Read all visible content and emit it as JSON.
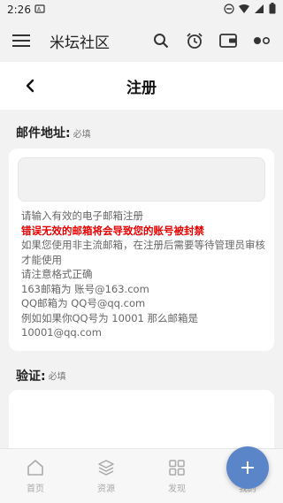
{
  "status_bar": {
    "time": "2:26"
  },
  "app_bar": {
    "title": "米坛社区"
  },
  "page": {
    "title": "注册"
  },
  "email_section": {
    "label": "邮件地址:",
    "required": "必填",
    "input_value": "",
    "hints": [
      "请输入有效的电子邮箱注册",
      "错误无效的邮箱将会导致您的账号被封禁",
      "如果您使用非主流邮箱，在注册后需要等待管理员审核才能使用",
      "请注意格式正确",
      "163邮箱为 账号@163.com",
      "QQ邮箱为 QQ号@qq.com",
      "例如如果你QQ号为 10001 那么邮箱是 10001@qq.com"
    ]
  },
  "verify_section": {
    "label": "验证:",
    "required": "必填"
  },
  "bottom_nav": [
    {
      "label": "首页",
      "icon": "home-icon"
    },
    {
      "label": "资源",
      "icon": "layers-icon"
    },
    {
      "label": "发现",
      "icon": "grid-icon"
    },
    {
      "label": "我的",
      "icon": "user-icon"
    }
  ],
  "colors": {
    "accent": "#5a86c9",
    "warning": "#e60000"
  }
}
